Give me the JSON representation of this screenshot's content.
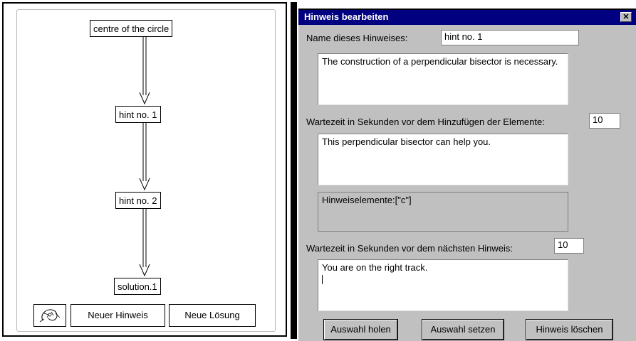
{
  "tree": {
    "nodes": [
      {
        "label": "centre of the circle"
      },
      {
        "label": "hint no. 1"
      },
      {
        "label": "hint no. 2"
      },
      {
        "label": "solution.1"
      }
    ],
    "buttons": {
      "icon": "editor-logo-icon",
      "new_hint": "Neuer Hinweis",
      "new_solution": "Neue Lösung"
    }
  },
  "dialog": {
    "title": "Hinweis bearbeiten",
    "close_icon": "close-icon",
    "name_label": "Name dieses Hinweises:",
    "name_value": "hint no. 1",
    "hint_text": "The construction of a perpendicular bisector is necessary.",
    "wait_add_label": "Wartezeit in Sekunden vor dem Hinzufügen der Elemente:",
    "wait_add_value": "10",
    "element_text": "This perpendicular bisector can help you.",
    "elements_info": "Hinweiselemente:[\"c\"]",
    "wait_next_label": "Wartezeit in Sekunden vor dem nächsten Hinweis:",
    "wait_next_value": "10",
    "feedback_text": "You are on the right track.",
    "buttons": {
      "fetch": "Auswahl holen",
      "set": "Auswahl setzen",
      "delete": "Hinweis löschen"
    }
  }
}
